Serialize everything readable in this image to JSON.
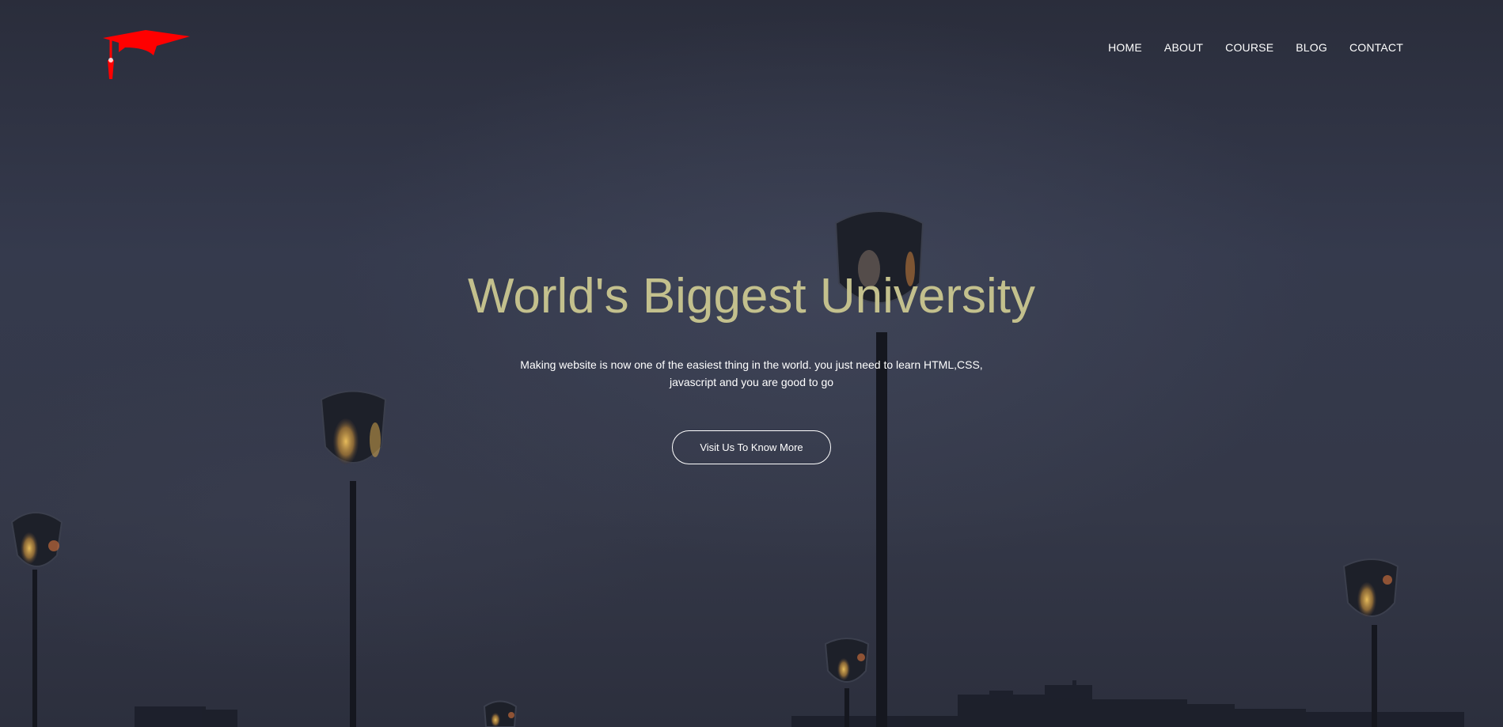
{
  "logo": {
    "icon": "graduation-cap-icon",
    "color": "#ff0000"
  },
  "nav": {
    "items": [
      "HOME",
      "ABOUT",
      "COURSE",
      "BLOG",
      "CONTACT"
    ]
  },
  "hero": {
    "title": "World's Biggest University",
    "subtitle": "Making website is now one of the easiest thing in the world. you just need to learn HTML,CSS, javascript and you are good to go",
    "button_label": "Visit Us To Know More"
  },
  "colors": {
    "title": "#c3c08d",
    "background": "#343848",
    "text": "#ffffff"
  }
}
